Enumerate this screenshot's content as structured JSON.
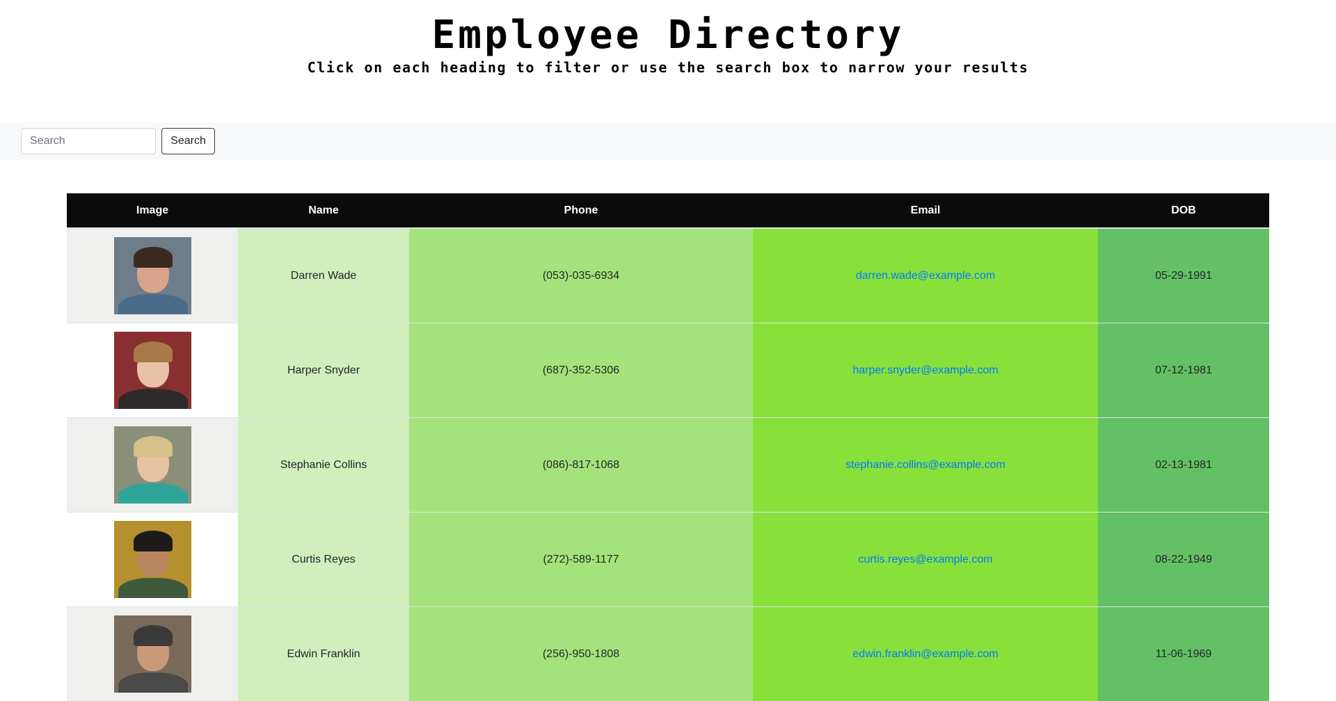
{
  "header": {
    "title": "Employee Directory",
    "subtitle": "Click on each heading to filter or use the search box to narrow your results"
  },
  "search": {
    "placeholder": "Search",
    "button_label": "Search"
  },
  "table": {
    "columns": [
      "Image",
      "Name",
      "Phone",
      "Email",
      "DOB"
    ],
    "rows": [
      {
        "name": "Darren Wade",
        "phone": "(053)-035-6934",
        "email": "darren.wade@example.com",
        "dob": "05-29-1991",
        "photo": {
          "bg": "#6e7d8a",
          "skin": "#d9a48b",
          "hair": "#3b2a20",
          "clothes": "#4a6a8a"
        }
      },
      {
        "name": "Harper Snyder",
        "phone": "(687)-352-5306",
        "email": "harper.snyder@example.com",
        "dob": "07-12-1981",
        "photo": {
          "bg": "#8a2f2f",
          "skin": "#e8c3a8",
          "hair": "#a87a4a",
          "clothes": "#2e2a2a"
        }
      },
      {
        "name": "Stephanie Collins",
        "phone": "(086)-817-1068",
        "email": "stephanie.collins@example.com",
        "dob": "02-13-1981",
        "photo": {
          "bg": "#8a8f7a",
          "skin": "#e6c2a0",
          "hair": "#d8c08a",
          "clothes": "#2fa59a"
        }
      },
      {
        "name": "Curtis Reyes",
        "phone": "(272)-589-1177",
        "email": "curtis.reyes@example.com",
        "dob": "08-22-1949",
        "photo": {
          "bg": "#b5902f",
          "skin": "#b98560",
          "hair": "#1e1a18",
          "clothes": "#3f5a3a"
        }
      },
      {
        "name": "Edwin Franklin",
        "phone": "(256)-950-1808",
        "email": "edwin.franklin@example.com",
        "dob": "11-06-1969",
        "photo": {
          "bg": "#7a6a5a",
          "skin": "#c99a7a",
          "hair": "#3a3a3a",
          "clothes": "#4a4a4a"
        }
      }
    ]
  },
  "colors": {
    "header_bg": "#0b0b0b",
    "name_col": "#d0efbd",
    "phone_col": "#a4e37b",
    "email_col": "#88e03a",
    "dob_col": "#63c064",
    "link": "#007bff"
  }
}
